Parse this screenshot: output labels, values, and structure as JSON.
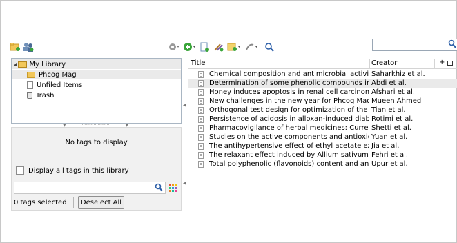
{
  "toolbar": {
    "icons": [
      "new-collection-icon",
      "new-group-icon",
      "actions-gear-icon",
      "new-item-icon",
      "new-item-by-identifier-icon",
      "add-attachment-icon",
      "new-note-icon",
      "attach-link-icon",
      "advanced-search-icon"
    ],
    "search_placeholder": ""
  },
  "collections": {
    "items": [
      {
        "label": "My Library"
      },
      {
        "label": "Phcog Mag"
      },
      {
        "label": "Unfiled Items"
      },
      {
        "label": "Trash"
      }
    ]
  },
  "tag_selector": {
    "no_tags_text": "No tags to display",
    "display_all_label": "Display all tags in this library",
    "filter_placeholder": "",
    "tags_selected": "0 tags selected",
    "deselect_label": "Deselect All"
  },
  "items_table": {
    "headers": {
      "title": "Title",
      "creator": "Creator",
      "plus": "+"
    },
    "rows": [
      {
        "title": "Chemical composition and antimicrobial activitie...",
        "creator": "Saharkhiz et al."
      },
      {
        "title": "Determination of some phenolic compounds in ...",
        "creator": "Abdi et al."
      },
      {
        "title": "Honey induces apoptosis in renal cell carcinoma",
        "creator": "Afshari et al."
      },
      {
        "title": "New challenges in the new year for Phcog Mag.: ...",
        "creator": "Mueen Ahmed"
      },
      {
        "title": "Orthogonal test design for optimization of the ext...",
        "creator": "Tian et al."
      },
      {
        "title": "Persistence of acidosis in alloxan-induced diabeti...",
        "creator": "Rotimi et al."
      },
      {
        "title": "Pharmacovigilance of herbal medicines: Current ...",
        "creator": "Shetti et al."
      },
      {
        "title": "Studies on the active components and antioxidan...",
        "creator": "Yuan et al."
      },
      {
        "title": "The antihypertensive effect of ethyl acetate extrac...",
        "creator": "Jia et al."
      },
      {
        "title": "The relaxant effect induced by Allium sativum L. ...",
        "creator": "Fehri et al."
      },
      {
        "title": "Total polyphenolic (flavonoids) content and anti...",
        "creator": "Upur et al."
      }
    ]
  },
  "colors": {
    "folder": "#f2c75a",
    "search_glass": "#2d5fa8",
    "selection": "#eaeaea"
  }
}
